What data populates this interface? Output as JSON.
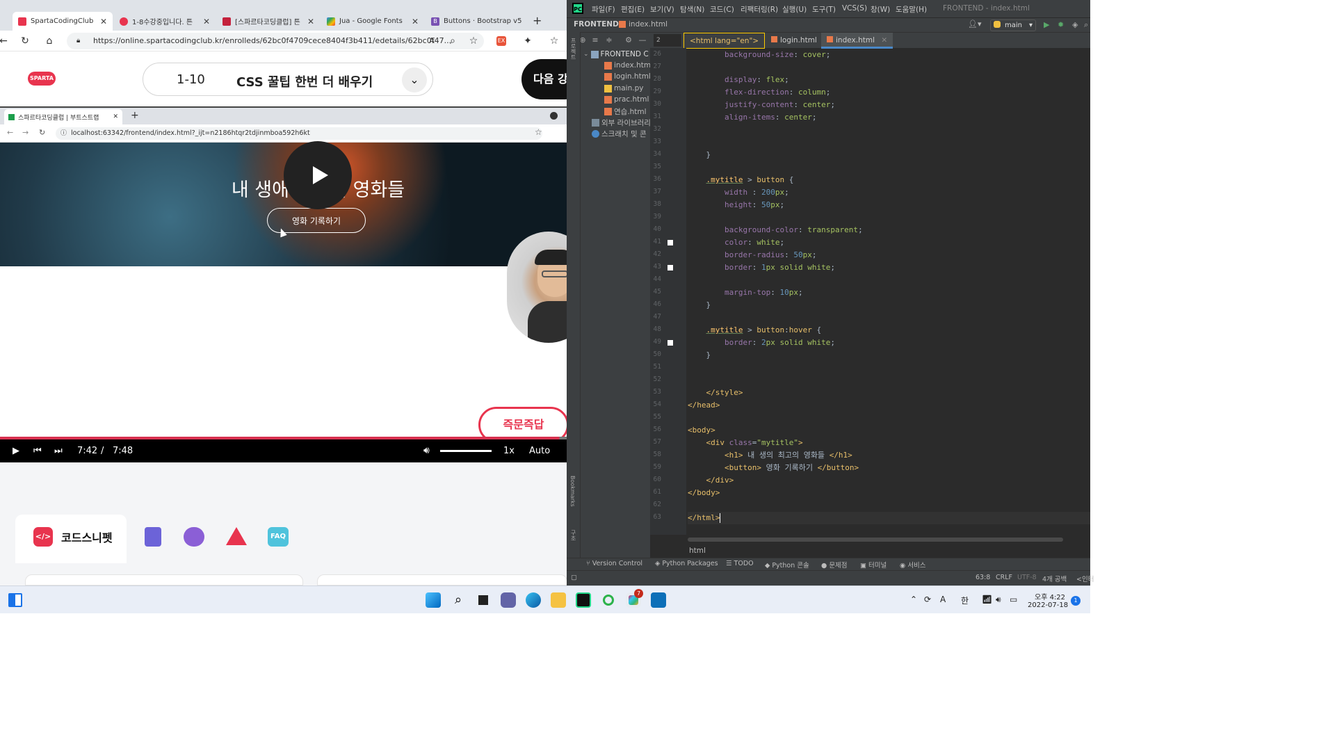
{
  "browser": {
    "tabs": [
      {
        "label": "SpartaCodingClub",
        "color": "#e8344e"
      },
      {
        "label": "1-8수강중입니다. 튼",
        "color": "#e8344e"
      },
      {
        "label": "[스파르타코딩클럽] 튼",
        "color": "#e8344e"
      },
      {
        "label": "Jua - Google Fonts",
        "color": "#4285f4"
      },
      {
        "label": "Buttons · Bootstrap v5",
        "color": "#7952b3"
      }
    ],
    "new_tab_label": "+",
    "url": "https://online.spartacodingclub.kr/enrolleds/62bc0f4709cece8404f3b411/edetails/62bc0f47...",
    "course": {
      "logo_text": "SPARTA",
      "lesson_number": "1-10",
      "lesson_title": "CSS 꿀팁 한번 더 배우기",
      "next_button": "다음 강"
    },
    "inner": {
      "tab_label": "스파르타코딩클럽 | 부트스트랩",
      "url": "localhost:63342/frontend/index.html?_ijt=n2186htqr2tdjinmboa592h6kt",
      "hero_title": "내 생애 최고의 영화들",
      "hero_button": "영화 기록하기"
    },
    "video": {
      "current_time": "7:42",
      "separator": "/",
      "duration": "7:48",
      "speed": "1x",
      "quality": "Auto",
      "qa_badge": "즉문즉답",
      "progress": 0.987
    },
    "snippet_panel": {
      "active_label": "코드스니펫",
      "active_icon_text": "</>",
      "faq_label": "FAQ"
    }
  },
  "ide": {
    "menu": [
      "파일(F)",
      "편집(E)",
      "보기(V)",
      "탐색(N)",
      "코드(C)",
      "리팩터링(R)",
      "실행(U)",
      "도구(T)",
      "VCS(S)",
      "창(W)",
      "도움말(H)"
    ],
    "window_title": "FRONTEND - index.html",
    "nav_project": "FRONTEND",
    "nav_file": "index.html",
    "run_config": "main",
    "line_input": "2",
    "editor_tabs": [
      {
        "label": "<html lang=\"en\">",
        "kind": "first"
      },
      {
        "label": "login.html",
        "kind": "normal"
      },
      {
        "label": "index.html",
        "kind": "selected"
      }
    ],
    "left_strip_labels": [
      "프로젝트",
      "Bookmarks",
      "구조"
    ],
    "project_tree": [
      {
        "label": "FRONTEND  C",
        "kind": "root"
      },
      {
        "label": "index.html",
        "kind": "html"
      },
      {
        "label": "login.html",
        "kind": "html"
      },
      {
        "label": "main.py",
        "kind": "py"
      },
      {
        "label": "prac.html",
        "kind": "html"
      },
      {
        "label": "연습.html",
        "kind": "html"
      },
      {
        "label": "외부 라이브러리",
        "kind": "lib"
      },
      {
        "label": "스크래치 및 콘",
        "kind": "scratch"
      }
    ],
    "code_lines": [
      {
        "n": "26",
        "parts": [
          [
            "txt",
            "        "
          ],
          [
            "p",
            "background-size"
          ],
          [
            "txt",
            ": "
          ],
          [
            "v",
            "cover"
          ],
          [
            "txt",
            ";"
          ]
        ]
      },
      {
        "n": "27",
        "parts": []
      },
      {
        "n": "28",
        "parts": [
          [
            "txt",
            "        "
          ],
          [
            "p",
            "display"
          ],
          [
            "txt",
            ": "
          ],
          [
            "v",
            "flex"
          ],
          [
            "txt",
            ";"
          ]
        ]
      },
      {
        "n": "29",
        "parts": [
          [
            "txt",
            "        "
          ],
          [
            "p",
            "flex-direction"
          ],
          [
            "txt",
            ": "
          ],
          [
            "v",
            "column"
          ],
          [
            "txt",
            ";"
          ]
        ]
      },
      {
        "n": "30",
        "parts": [
          [
            "txt",
            "        "
          ],
          [
            "p",
            "justify-content"
          ],
          [
            "txt",
            ": "
          ],
          [
            "v",
            "center"
          ],
          [
            "txt",
            ";"
          ]
        ]
      },
      {
        "n": "31",
        "parts": [
          [
            "txt",
            "        "
          ],
          [
            "p",
            "align-items"
          ],
          [
            "txt",
            ": "
          ],
          [
            "v",
            "center"
          ],
          [
            "txt",
            ";"
          ]
        ]
      },
      {
        "n": "32",
        "parts": []
      },
      {
        "n": "33",
        "parts": []
      },
      {
        "n": "34",
        "parts": [
          [
            "txt",
            "    }"
          ]
        ]
      },
      {
        "n": "35",
        "parts": []
      },
      {
        "n": "36",
        "parts": [
          [
            "txt",
            "    "
          ],
          [
            "cls",
            ".mytitle"
          ],
          [
            "txt",
            " > "
          ],
          [
            "k",
            "button"
          ],
          [
            "txt",
            " {"
          ]
        ]
      },
      {
        "n": "37",
        "parts": [
          [
            "txt",
            "        "
          ],
          [
            "p",
            "width"
          ],
          [
            "txt",
            " : "
          ],
          [
            "n",
            "200"
          ],
          [
            "v",
            "px"
          ],
          [
            "txt",
            ";"
          ]
        ]
      },
      {
        "n": "38",
        "parts": [
          [
            "txt",
            "        "
          ],
          [
            "p",
            "height"
          ],
          [
            "txt",
            ": "
          ],
          [
            "n",
            "50"
          ],
          [
            "v",
            "px"
          ],
          [
            "txt",
            ";"
          ]
        ]
      },
      {
        "n": "39",
        "parts": []
      },
      {
        "n": "40",
        "parts": [
          [
            "txt",
            "        "
          ],
          [
            "p",
            "background-color"
          ],
          [
            "txt",
            ": "
          ],
          [
            "v",
            "transparent"
          ],
          [
            "txt",
            ";"
          ]
        ]
      },
      {
        "n": "41",
        "parts": [
          [
            "txt",
            "        "
          ],
          [
            "p",
            "color"
          ],
          [
            "txt",
            ": "
          ],
          [
            "v",
            "white"
          ],
          [
            "txt",
            ";"
          ]
        ]
      },
      {
        "n": "42",
        "parts": [
          [
            "txt",
            "        "
          ],
          [
            "p",
            "border-radius"
          ],
          [
            "txt",
            ": "
          ],
          [
            "n",
            "50"
          ],
          [
            "v",
            "px"
          ],
          [
            "txt",
            ";"
          ]
        ]
      },
      {
        "n": "43",
        "parts": [
          [
            "txt",
            "        "
          ],
          [
            "p",
            "border"
          ],
          [
            "txt",
            ": "
          ],
          [
            "n",
            "1"
          ],
          [
            "v",
            "px solid white"
          ],
          [
            "txt",
            ";"
          ]
        ]
      },
      {
        "n": "44",
        "parts": []
      },
      {
        "n": "45",
        "parts": [
          [
            "txt",
            "        "
          ],
          [
            "p",
            "margin-top"
          ],
          [
            "txt",
            ": "
          ],
          [
            "n",
            "10"
          ],
          [
            "v",
            "px"
          ],
          [
            "txt",
            ";"
          ]
        ]
      },
      {
        "n": "46",
        "parts": [
          [
            "txt",
            "    }"
          ]
        ]
      },
      {
        "n": "47",
        "parts": []
      },
      {
        "n": "48",
        "parts": [
          [
            "txt",
            "    "
          ],
          [
            "cls",
            ".mytitle"
          ],
          [
            "txt",
            " > "
          ],
          [
            "k",
            "button"
          ],
          [
            "txt",
            ":"
          ],
          [
            "k",
            "hover"
          ],
          [
            "txt",
            " {"
          ]
        ]
      },
      {
        "n": "49",
        "parts": [
          [
            "txt",
            "        "
          ],
          [
            "p",
            "border"
          ],
          [
            "txt",
            ": "
          ],
          [
            "n",
            "2"
          ],
          [
            "v",
            "px solid white"
          ],
          [
            "txt",
            ";"
          ]
        ]
      },
      {
        "n": "50",
        "parts": [
          [
            "txt",
            "    }"
          ]
        ]
      },
      {
        "n": "51",
        "parts": []
      },
      {
        "n": "52",
        "parts": []
      },
      {
        "n": "53",
        "parts": [
          [
            "txt",
            "    "
          ],
          [
            "k",
            "</style>"
          ]
        ]
      },
      {
        "n": "54",
        "parts": [
          [
            "k",
            "</head>"
          ]
        ]
      },
      {
        "n": "55",
        "parts": []
      },
      {
        "n": "56",
        "parts": [
          [
            "k",
            "<body>"
          ]
        ]
      },
      {
        "n": "57",
        "parts": [
          [
            "txt",
            "    "
          ],
          [
            "k",
            "<div "
          ],
          [
            "p",
            "class"
          ],
          [
            "txt",
            "="
          ],
          [
            "v",
            "\"mytitle\""
          ],
          [
            "k",
            ">"
          ]
        ]
      },
      {
        "n": "58",
        "parts": [
          [
            "txt",
            "        "
          ],
          [
            "k",
            "<h1>"
          ],
          [
            "txt",
            " 내 생의 최고의 영화들 "
          ],
          [
            "k",
            "</h1>"
          ]
        ]
      },
      {
        "n": "59",
        "parts": [
          [
            "txt",
            "        "
          ],
          [
            "k",
            "<button>"
          ],
          [
            "txt",
            " 영화 기록하기 "
          ],
          [
            "k",
            "</button>"
          ]
        ]
      },
      {
        "n": "60",
        "parts": [
          [
            "txt",
            "    "
          ],
          [
            "k",
            "</div>"
          ]
        ]
      },
      {
        "n": "61",
        "parts": [
          [
            "k",
            "</body>"
          ]
        ]
      },
      {
        "n": "62",
        "parts": []
      },
      {
        "n": "63",
        "parts": [
          [
            "k",
            "</html>"
          ]
        ]
      }
    ],
    "breakpoint_lines": [
      "41",
      "43",
      "49"
    ],
    "current_line": "63",
    "breadcrumb": "html",
    "bottom_tabs": [
      "Version Control",
      "Python Packages",
      "TODO",
      "Python 콘솔",
      "문제점",
      "터미널",
      "서비스"
    ],
    "status": {
      "position": "63:8",
      "line_sep": "CRLF",
      "encoding": "UTF-8",
      "indent": "4개 공백",
      "extra": "<인터"
    }
  },
  "taskbar": {
    "time": "오후 4:22",
    "date": "2022-07-18",
    "ime_a": "A",
    "ime_ko": "한",
    "notifications": "1",
    "slack_badge": "7"
  },
  "colors": {
    "sparta_red": "#e8344e",
    "ide_bg": "#2b2b2b",
    "ide_panel": "#3c3f41",
    "progress_red": "#d93250"
  }
}
